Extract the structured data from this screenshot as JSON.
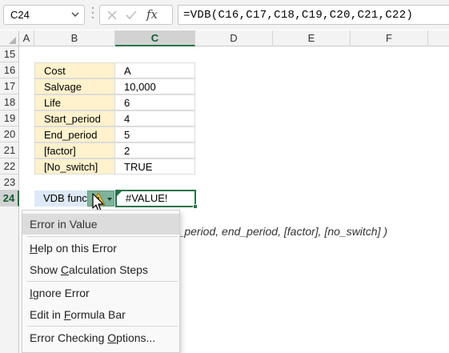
{
  "formula_bar": {
    "name_box": "C24",
    "fx_label": "fx",
    "formula": "=VDB(C16,C17,C18,C19,C20,C21,C22)"
  },
  "columns": [
    "A",
    "B",
    "C",
    "D",
    "E",
    "F"
  ],
  "rows": [
    "15",
    "16",
    "17",
    "18",
    "19",
    "20",
    "21",
    "22",
    "23",
    "24"
  ],
  "table": [
    {
      "label": "Cost",
      "value": "A"
    },
    {
      "label": "Salvage",
      "value": "10,000"
    },
    {
      "label": "Life",
      "value": "6"
    },
    {
      "label": "Start_period",
      "value": "4"
    },
    {
      "label": "End_period",
      "value": "5"
    },
    {
      "label": "[factor]",
      "value": "2"
    },
    {
      "label": "[No_switch]",
      "value": "TRUE"
    }
  ],
  "result_row": {
    "label": "VDB function",
    "value": "#VALUE!"
  },
  "syntax_tooltip": "rt_period, end_period, [factor], [no_switch] )",
  "error_menu": {
    "header": "Error in Value",
    "items": [
      {
        "pre": "",
        "key": "H",
        "post": "elp on this Error"
      },
      {
        "pre": "Show ",
        "key": "C",
        "post": "alculation Steps"
      },
      {
        "pre": "",
        "key": "I",
        "post": "gnore Error"
      },
      {
        "pre": "Edit in ",
        "key": "F",
        "post": "ormula Bar"
      },
      {
        "pre": "Error Checking ",
        "key": "O",
        "post": "ptions..."
      }
    ]
  },
  "colors": {
    "accent_green": "#217346",
    "label_fill": "#fff2cc",
    "result_label_fill": "#dde9f7"
  }
}
